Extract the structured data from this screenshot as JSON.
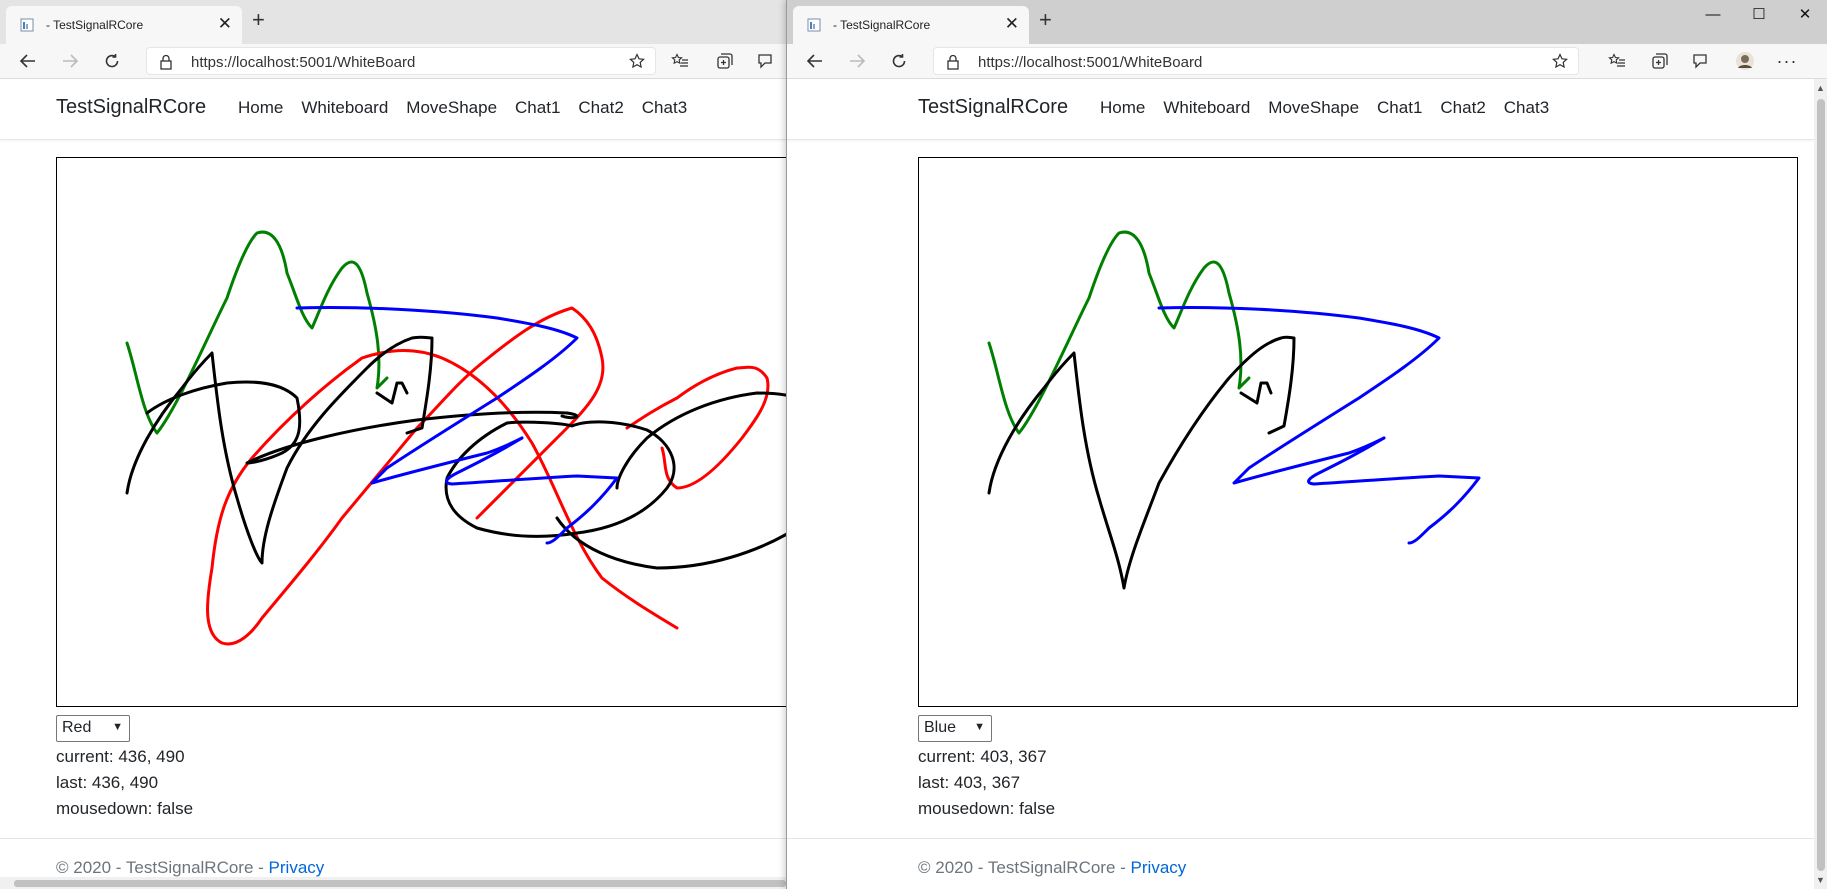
{
  "colors": {
    "accent": "#0366d6",
    "stroke_black": "#000000",
    "stroke_red": "#ff0000",
    "stroke_green": "#008000",
    "stroke_blue": "#0000ff"
  },
  "left_window": {
    "tab": {
      "title": "- TestSignalRCore",
      "favicon": "page-icon"
    },
    "address": {
      "url": "https://localhost:5001/WhiteBoard"
    },
    "nav": {
      "brand": "TestSignalRCore",
      "links": [
        "Home",
        "Whiteboard",
        "MoveShape",
        "Chat1",
        "Chat2",
        "Chat3"
      ]
    },
    "color_select": {
      "value": "Red"
    },
    "status": {
      "current": "current: 436, 490",
      "last": "last: 436, 490",
      "mousedown": "mousedown: false"
    },
    "footer": {
      "text": "© 2020 - TestSignalRCore - ",
      "privacy": "Privacy"
    }
  },
  "right_window": {
    "tab": {
      "title": "- TestSignalRCore",
      "favicon": "page-icon"
    },
    "address": {
      "url": "https://localhost:5001/WhiteBoard"
    },
    "nav": {
      "brand": "TestSignalRCore",
      "links": [
        "Home",
        "Whiteboard",
        "MoveShape",
        "Chat1",
        "Chat2",
        "Chat3"
      ]
    },
    "color_select": {
      "value": "Blue"
    },
    "status": {
      "current": "current: 403, 367",
      "last": "last: 403, 367",
      "mousedown": "mousedown: false"
    },
    "footer": {
      "text": "© 2020 - TestSignalRCore - ",
      "privacy": "Privacy"
    }
  },
  "window_controls": [
    "minimize-icon",
    "maximize-icon",
    "close-icon"
  ]
}
